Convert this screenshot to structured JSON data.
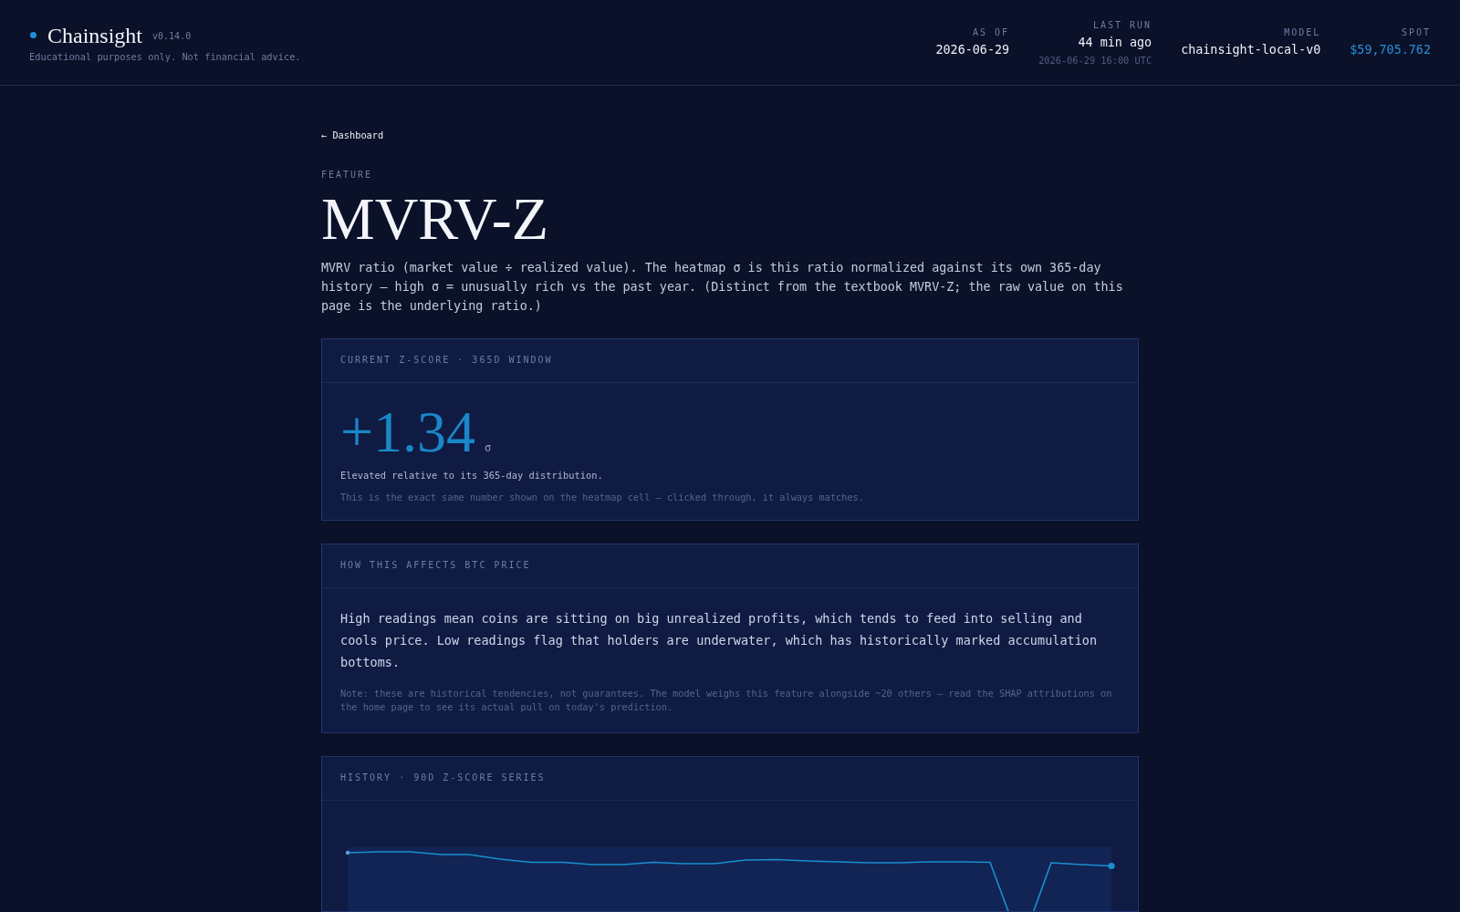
{
  "header": {
    "brand": {
      "name": "Chainsight",
      "version": "v0.14.0"
    },
    "disclaimer": "Educational purposes only. Not financial advice.",
    "stats": [
      {
        "kind": "plain",
        "label": "AS OF",
        "value": "2026-06-29"
      },
      {
        "kind": "plain",
        "label": "LAST RUN",
        "value": "44 min ago",
        "detail": "2026-06-29 16:00 UTC"
      },
      {
        "kind": "plain",
        "label": "MODEL",
        "value": "chainsight-local-v0"
      },
      {
        "kind": "accent",
        "label": "SPOT",
        "value": "$59,705.762"
      }
    ]
  },
  "back_link": "← Dashboard",
  "eyebrow": "FEATURE",
  "title": "MVRV-Z",
  "description": "MVRV ratio (market value ÷ realized value). The heatmap σ is this ratio normalized against its own 365-day history — high σ = unusually rich vs the past year. (Distinct from the textbook MVRV-Z; the raw value on this page is the underlying ratio.)",
  "cards": [
    {
      "kind": "score",
      "heading": "CURRENT Z-SCORE · 365D WINDOW",
      "value": "+1.34",
      "unit": "σ",
      "summary": "Elevated relative to its 365-day distribution.",
      "note": "This is the exact same number shown on the heatmap cell — clicked through, it always matches."
    },
    {
      "kind": "text",
      "heading": "HOW THIS AFFECTS BTC PRICE",
      "body": "High readings mean coins are sitting on big unrealized profits, which tends to feed into selling and cools price. Low readings flag that holders are underwater, which has historically marked accumulation bottoms.",
      "note": "Note: these are historical tendencies, not guarantees. The model weighs this feature alongside ~20 others — read the SHAP attributions on the home page to see its actual pull on today's prediction."
    },
    {
      "kind": "chart",
      "heading": "HISTORY · 90D Z-SCORE SERIES"
    }
  ]
}
